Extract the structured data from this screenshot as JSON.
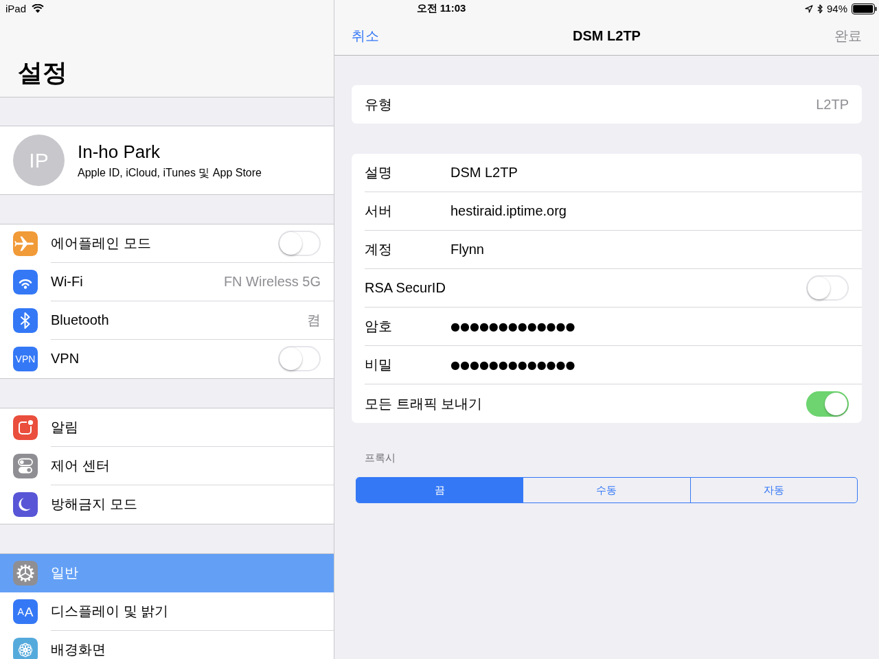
{
  "status_bar": {
    "device": "iPad",
    "time": "오전 11:03",
    "battery": "94%"
  },
  "sidebar": {
    "title": "설정",
    "profile": {
      "initials": "IP",
      "name": "In-ho Park",
      "subtitle": "Apple ID, iCloud, iTunes 및 App Store"
    },
    "groups": [
      {
        "items": [
          {
            "kind": "toggle",
            "label": "에어플레인 모드",
            "color": "#f19a38",
            "on": false,
            "selected": false
          },
          {
            "kind": "value",
            "label": "Wi-Fi",
            "color": "#3478f6",
            "value": "FN Wireless 5G",
            "selected": false
          },
          {
            "kind": "value",
            "label": "Bluetooth",
            "color": "#3478f6",
            "value": "켬",
            "selected": false
          },
          {
            "kind": "toggle",
            "label": "VPN",
            "color": "#3478f6",
            "icon_text": "VPN",
            "on": false,
            "selected": false
          }
        ]
      },
      {
        "items": [
          {
            "kind": "link",
            "label": "알림",
            "color": "#ea4e3d",
            "selected": false
          },
          {
            "kind": "link",
            "label": "제어 센터",
            "color": "#8e8e93",
            "selected": false
          },
          {
            "kind": "link",
            "label": "방해금지 모드",
            "color": "#5856d6",
            "selected": false
          }
        ]
      },
      {
        "items": [
          {
            "kind": "link",
            "label": "일반",
            "color": "#8e8e93",
            "selected": true
          },
          {
            "kind": "link",
            "label": "디스플레이 및 밝기",
            "color": "#3478f6",
            "icon_text": "AA",
            "selected": false
          },
          {
            "kind": "link",
            "label": "배경화면",
            "color": "#55aadc",
            "selected": false
          }
        ]
      }
    ]
  },
  "detail": {
    "nav": {
      "cancel": "취소",
      "title": "DSM L2TP",
      "done": "완료",
      "done_disabled": true
    },
    "type_row": {
      "label": "유형",
      "value": "L2TP"
    },
    "fields": [
      {
        "kind": "text",
        "label": "설명",
        "value": "DSM L2TP"
      },
      {
        "kind": "text",
        "label": "서버",
        "value": "hestiraid.iptime.org"
      },
      {
        "kind": "text",
        "label": "계정",
        "value": "Flynn"
      },
      {
        "kind": "toggle",
        "label": "RSA SecurID",
        "on": false
      },
      {
        "kind": "secure",
        "label": "암호",
        "value": "●●●●●●●●●●●●●"
      },
      {
        "kind": "secure",
        "label": "비밀",
        "value": "●●●●●●●●●●●●●"
      },
      {
        "kind": "toggle",
        "label": "모든 트래픽 보내기",
        "on": true
      }
    ],
    "proxy": {
      "header": "프록시",
      "segments": [
        {
          "label": "끔",
          "selected": true
        },
        {
          "label": "수동",
          "selected": false
        },
        {
          "label": "자동",
          "selected": false
        }
      ]
    }
  }
}
